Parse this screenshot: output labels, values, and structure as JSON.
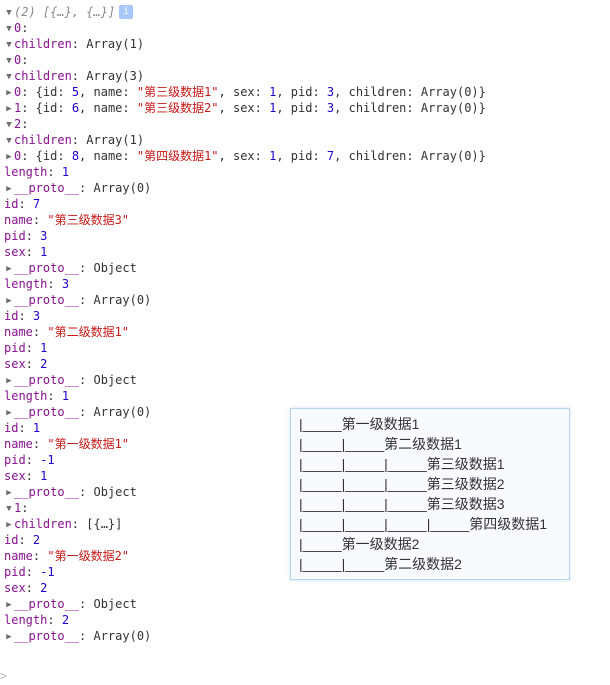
{
  "header": {
    "count": "(2)",
    "summary": "[{…}, {…}]"
  },
  "proto_obj": "Object",
  "proto_arr": "Array(0)",
  "obj0": {
    "index": "0",
    "children_label": "children",
    "children_type": "Array(1)",
    "id": "1",
    "name": "\"第一级数据1\"",
    "pid": "-1",
    "sex": "1",
    "length": "1"
  },
  "obj0_c0": {
    "index": "0",
    "children_label": "children",
    "children_type": "Array(3)",
    "line0": "0: {id: 5, name: \"第三级数据1\", sex: 1, pid: 3, children: Array(0)}",
    "line0_name": "\"第三级数据1\"",
    "line1": "1: {id: 6, name: \"第三级数据2\", sex: 1, pid: 3, children: Array(0)}",
    "line1_name": "\"第三级数据2\"",
    "id": "3",
    "name": "\"第二级数据1\"",
    "pid": "1",
    "sex": "2",
    "length": "3"
  },
  "obj0_c0_c2": {
    "index": "2",
    "children_label": "children",
    "children_type": "Array(1)",
    "line0": "0: {id: 8, name: \"第四级数据1\", sex: 1, pid: 7, children: Array(0)}",
    "line0_name": "\"第四级数据1\"",
    "id": "7",
    "name": "\"第三级数据3\"",
    "pid": "3",
    "sex": "1",
    "length": "1"
  },
  "obj1": {
    "index": "1",
    "children_label": "children",
    "children_type": "[{…}]",
    "id": "2",
    "name": "\"第一级数据2\"",
    "pid": "-1",
    "sex": "2"
  },
  "root_length": "2",
  "overlay": {
    "rows": [
      "|_____第一级数据1",
      "|_____|_____第二级数据1",
      "|_____|_____|_____第三级数据1",
      "|_____|_____|_____第三级数据2",
      "|_____|_____|_____第三级数据3",
      "|_____|_____|_____|_____第四级数据1",
      "|_____第一级数据2",
      "|_____|_____第二级数据2"
    ]
  }
}
